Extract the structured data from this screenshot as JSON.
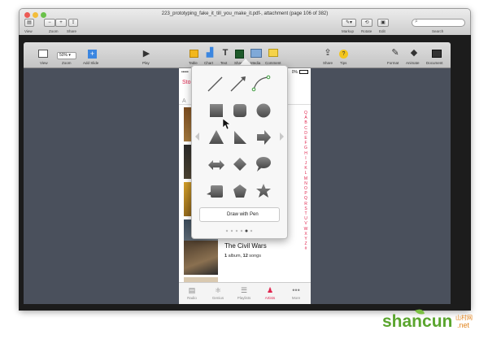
{
  "window": {
    "title": "223_prototyping_fake_it_till_you_make_it.pdf-, attachment (page 106 of 382)"
  },
  "preview_toolbar": {
    "view_label": "View",
    "zoom_label": "Zoom",
    "share_label": "Share",
    "markup_label": "Markup",
    "rotate_label": "Rotate",
    "edit_label": "Edit",
    "search_label": "Search"
  },
  "keynote_toolbar": {
    "view_label": "View",
    "zoom_value": "50%",
    "zoom_label": "Zoom",
    "add_slide_label": "Add Slide",
    "play_label": "Play",
    "table_label": "Table",
    "chart_label": "Chart",
    "text_label": "Text",
    "shape_label": "Shape",
    "media_label": "Media",
    "comment_label": "Comment",
    "share_label": "Share",
    "tips_label": "Tips",
    "format_label": "Format",
    "animate_label": "Animate",
    "document_label": "Document"
  },
  "phone": {
    "status_left": "•••••",
    "status_right": "0%",
    "nav_title": "Sto",
    "section_letter": "A",
    "album_title": "The Civil Wars",
    "album_count": "1",
    "album_count_suffix": " album, ",
    "song_count": "12",
    "song_count_suffix": " songs",
    "index_letters": [
      "Q",
      "A",
      "B",
      "C",
      "D",
      "E",
      "F",
      "G",
      "H",
      "I",
      "J",
      "K",
      "L",
      "M",
      "N",
      "O",
      "P",
      "Q",
      "R",
      "S",
      "T",
      "U",
      "V",
      "W",
      "X",
      "Y",
      "Z",
      "#"
    ],
    "tabs": [
      {
        "label": "Radio",
        "icon": "radio-icon",
        "glyph": "▤"
      },
      {
        "label": "Genius",
        "icon": "genius-icon",
        "glyph": "⚛"
      },
      {
        "label": "Playlists",
        "icon": "playlists-icon",
        "glyph": "☰"
      },
      {
        "label": "Artists",
        "icon": "artists-icon",
        "glyph": "♟"
      },
      {
        "label": "More",
        "icon": "more-icon",
        "glyph": "•••"
      }
    ]
  },
  "popover": {
    "draw_with_pen_label": "Draw with Pen",
    "accent_color": "#3c9a3c"
  },
  "watermark": {
    "text_main": "shancun",
    "text_cn": "山村网",
    "text_net": ".net"
  },
  "colors": {
    "accent_red": "#e0254e",
    "canvas": "#4a505c"
  }
}
